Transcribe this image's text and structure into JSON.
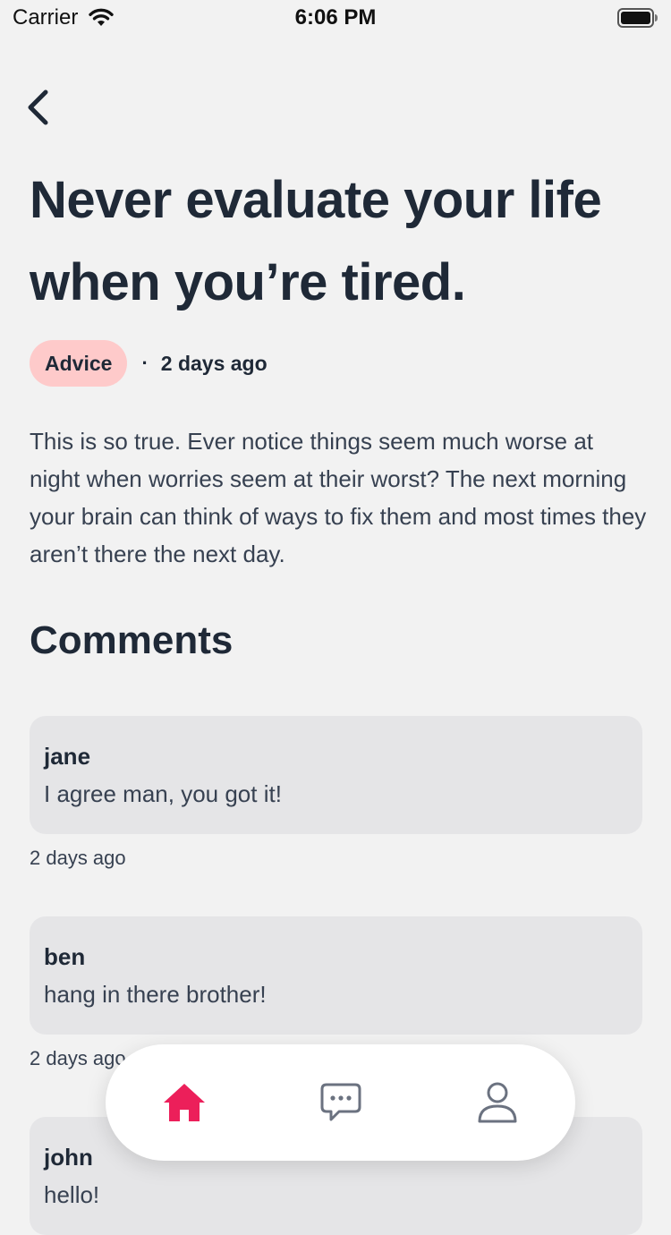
{
  "status_bar": {
    "carrier": "Carrier",
    "time": "6:06 PM",
    "icons": [
      "wifi-icon",
      "battery-icon"
    ]
  },
  "post": {
    "title": "Never evaluate your life when you’re tired.",
    "category": "Advice",
    "separator": "·",
    "date": "2 days ago",
    "body": "This is so true. Ever notice things seem much worse at night when worries seem at their worst? The next morning your brain can think of ways to fix them and most times they aren’t there the next day."
  },
  "comments": {
    "heading": "Comments",
    "items": [
      {
        "author": "jane",
        "text": "I agree man, you got it!",
        "date": "2 days ago"
      },
      {
        "author": "ben",
        "text": "hang in there brother!",
        "date": "2 days ago"
      },
      {
        "author": "john",
        "text": "hello!",
        "date": ""
      }
    ]
  },
  "tab_bar": {
    "tabs": [
      {
        "icon": "home-icon",
        "active": true
      },
      {
        "icon": "chat-icon",
        "active": false
      },
      {
        "icon": "user-icon",
        "active": false
      }
    ],
    "active_color": "#ec1f5a",
    "inactive_color": "#6b7280"
  },
  "colors": {
    "background": "#f2f2f2",
    "badge": "#fecaca",
    "comment_card": "#e5e5e7",
    "text_dark": "#1f2937"
  }
}
